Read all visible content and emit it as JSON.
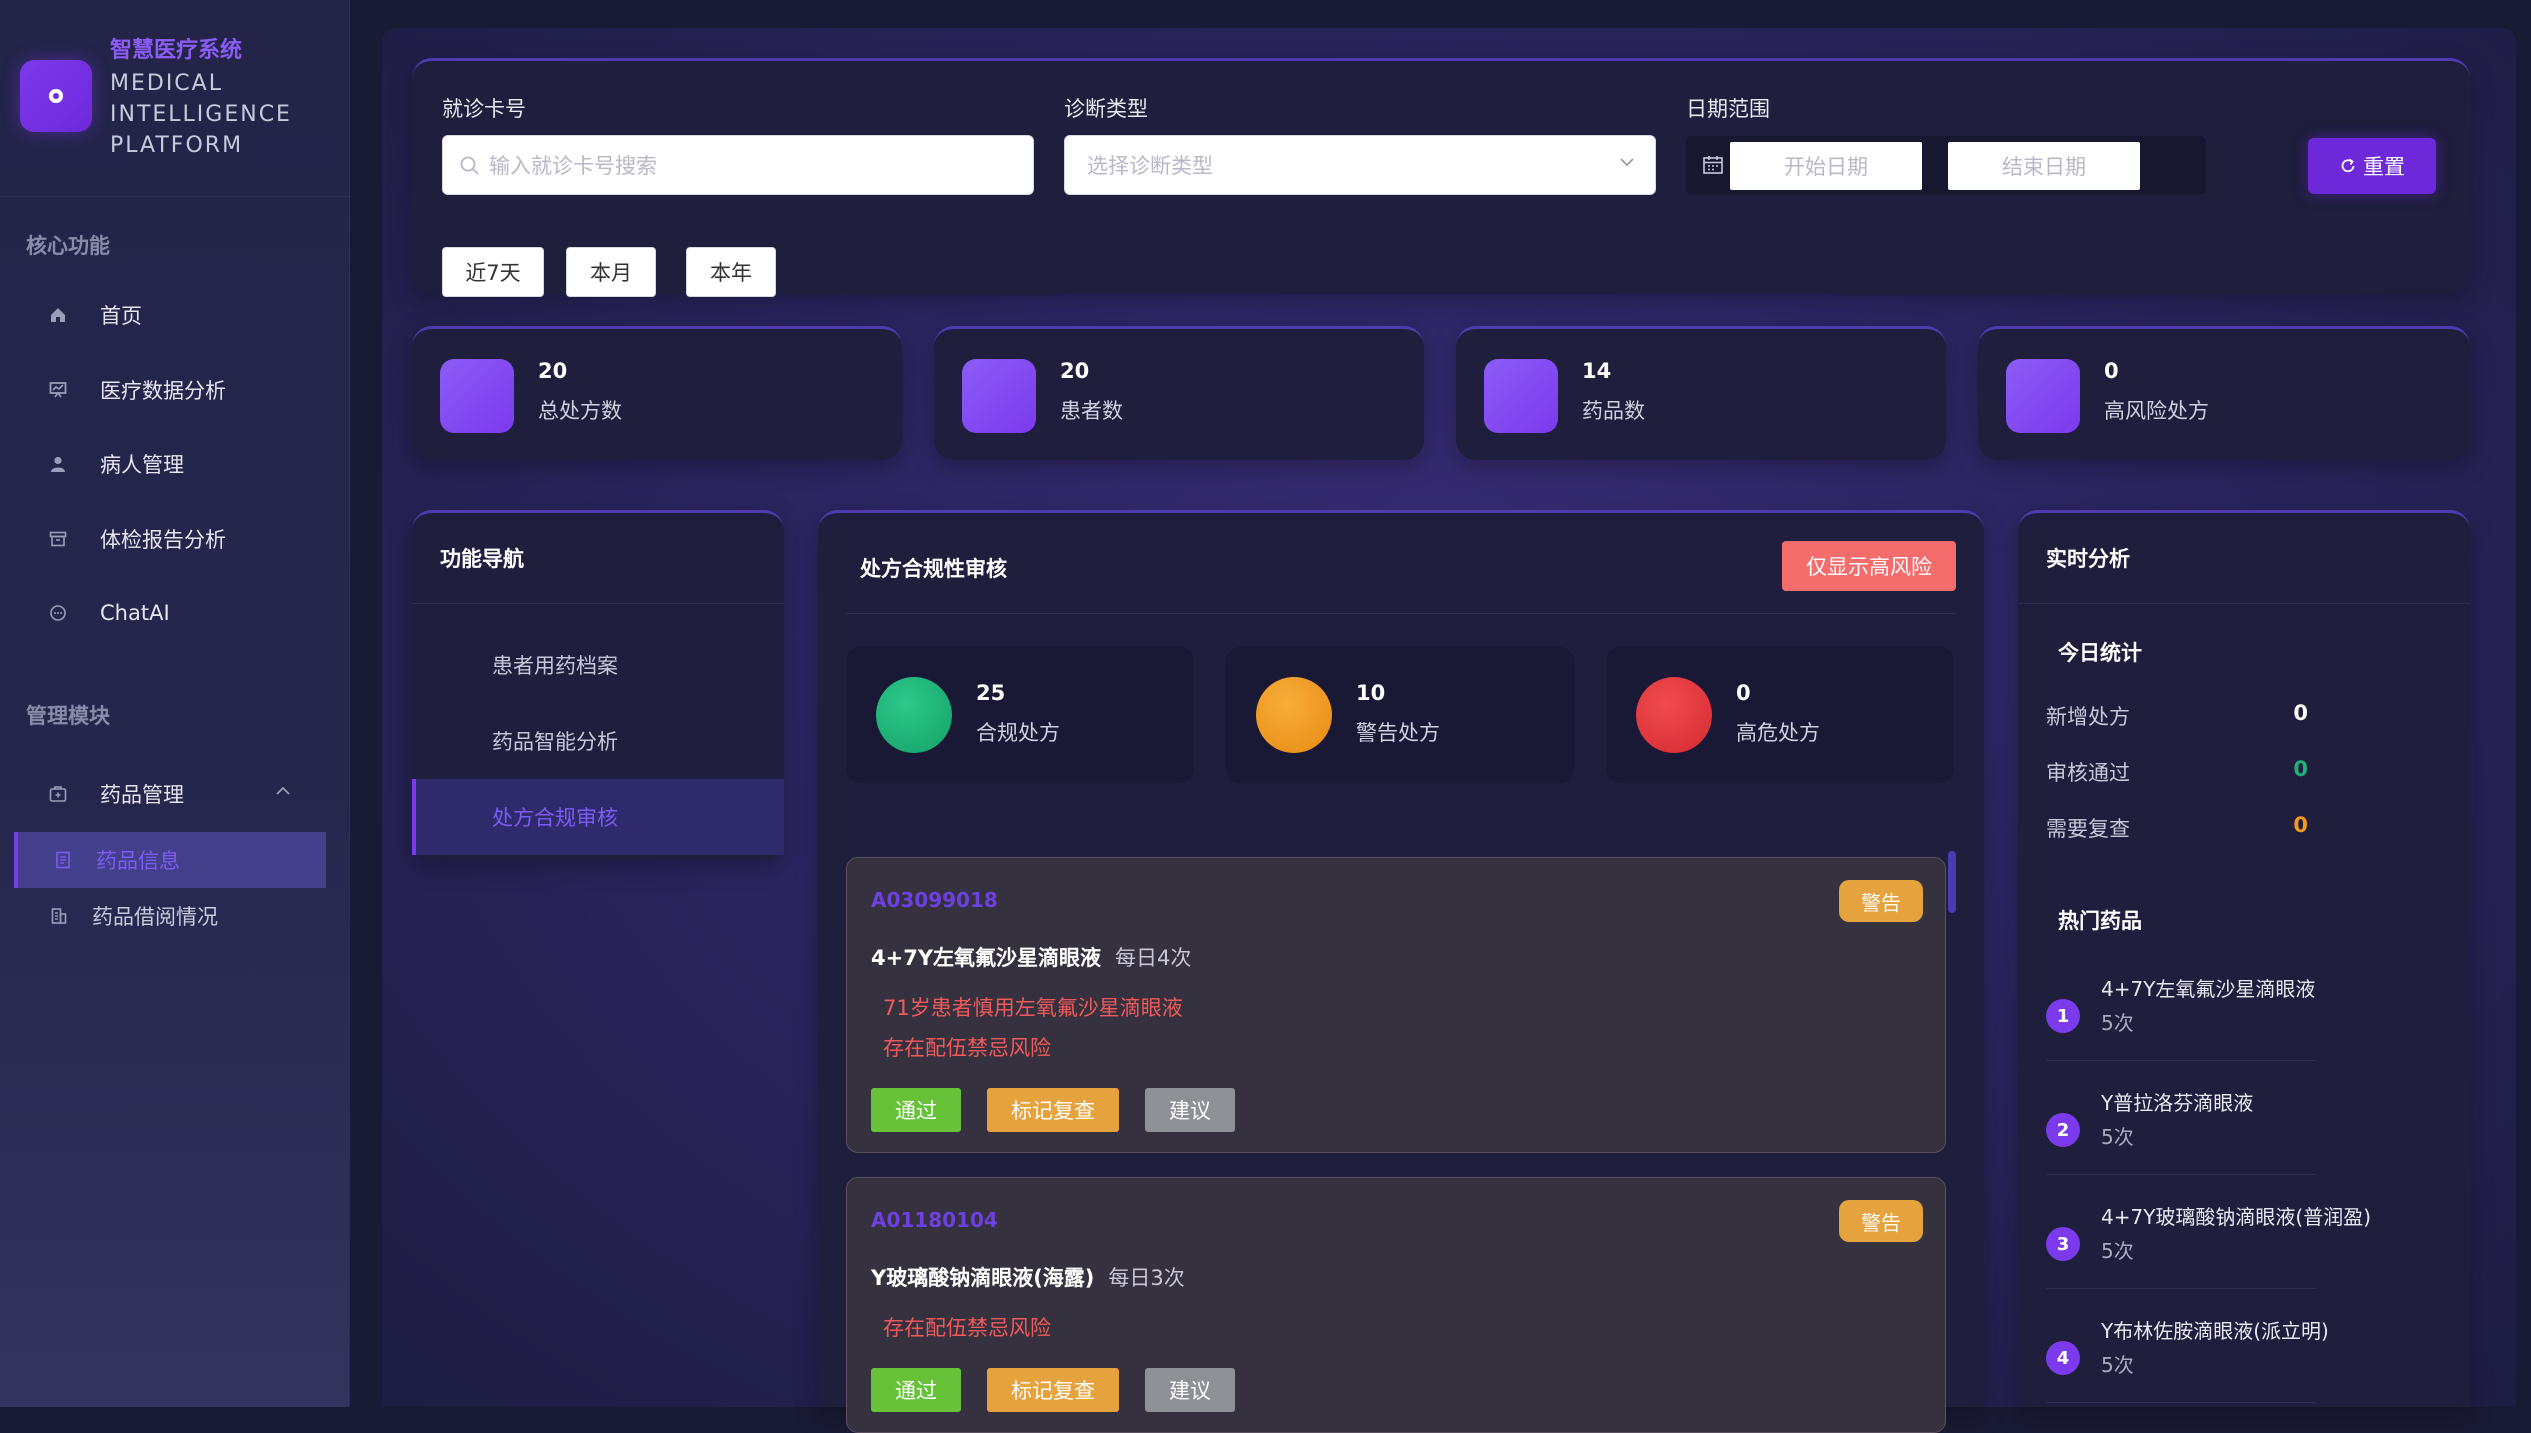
{
  "brand": {
    "cn": "智慧医疗系统",
    "en": "MEDICAL INTELLIGENCE PLATFORM"
  },
  "sidebar": {
    "section_core": "核心功能",
    "core_items": [
      {
        "label": "首页",
        "icon": "home-icon"
      },
      {
        "label": "医疗数据分析",
        "icon": "chart-icon"
      },
      {
        "label": "病人管理",
        "icon": "user-icon"
      },
      {
        "label": "体检报告分析",
        "icon": "archive-icon"
      },
      {
        "label": "ChatAI",
        "icon": "chat-icon"
      }
    ],
    "section_admin": "管理模块",
    "drug_mgmt": "药品管理",
    "sub_items": [
      {
        "label": "药品信息",
        "icon": "document-icon",
        "active": true
      },
      {
        "label": "药品借阅情况",
        "icon": "building-icon",
        "active": false
      }
    ]
  },
  "filters": {
    "card_label": "就诊卡号",
    "card_placeholder": "输入就诊卡号搜索",
    "diag_label": "诊断类型",
    "diag_placeholder": "选择诊断类型",
    "date_label": "日期范围",
    "start_placeholder": "开始日期",
    "end_placeholder": "结束日期",
    "reset": "重置",
    "quick": [
      "近7天",
      "本月",
      "本年"
    ]
  },
  "stats": [
    {
      "value": "20",
      "label": "总处方数"
    },
    {
      "value": "20",
      "label": "患者数"
    },
    {
      "value": "14",
      "label": "药品数"
    },
    {
      "value": "0",
      "label": "高风险处方"
    }
  ],
  "nav": {
    "title": "功能导航",
    "items": [
      {
        "label": "患者用药档案",
        "active": false
      },
      {
        "label": "药品智能分析",
        "active": false
      },
      {
        "label": "处方合规审核",
        "active": true
      }
    ]
  },
  "audit": {
    "title": "处方合规性审核",
    "filter_btn": "仅显示高风险",
    "summary": [
      {
        "value": "25",
        "label": "合规处方",
        "color": "#1eb277"
      },
      {
        "value": "10",
        "label": "警告处方",
        "color": "#f29a1b"
      },
      {
        "value": "0",
        "label": "高危处方",
        "color": "#e8383d"
      }
    ],
    "prescriptions": [
      {
        "id": "A03099018",
        "tag": "警告",
        "drug": "4+7Y左氧氟沙星滴眼液",
        "freq": "每日4次",
        "warnings": [
          "71岁患者慎用左氧氟沙星滴眼液",
          "存在配伍禁忌风险"
        ],
        "actions": [
          "通过",
          "标记复查",
          "建议"
        ]
      },
      {
        "id": "A01180104",
        "tag": "警告",
        "drug": "Y玻璃酸钠滴眼液(海露)",
        "freq": "每日3次",
        "warnings": [
          "存在配伍禁忌风险"
        ],
        "actions": [
          "通过",
          "标记复查",
          "建议"
        ]
      }
    ]
  },
  "realtime": {
    "title": "实时分析",
    "today_title": "今日统计",
    "today": [
      {
        "label": "新增处方",
        "value": "0",
        "color": "#ffffff"
      },
      {
        "label": "审核通过",
        "value": "0",
        "color": "#1eb277"
      },
      {
        "label": "需要复查",
        "value": "0",
        "color": "#f29a1b"
      }
    ],
    "hot_title": "热门药品",
    "hot": [
      {
        "rank": "1",
        "name": "4+7Y左氧氟沙星滴眼液",
        "count": "5次"
      },
      {
        "rank": "2",
        "name": "Y普拉洛芬滴眼液",
        "count": "5次"
      },
      {
        "rank": "3",
        "name": "4+7Y玻璃酸钠滴眼液(普润盈)",
        "count": "5次"
      },
      {
        "rank": "4",
        "name": "Y布林佐胺滴眼液(派立明)",
        "count": "5次"
      }
    ]
  }
}
